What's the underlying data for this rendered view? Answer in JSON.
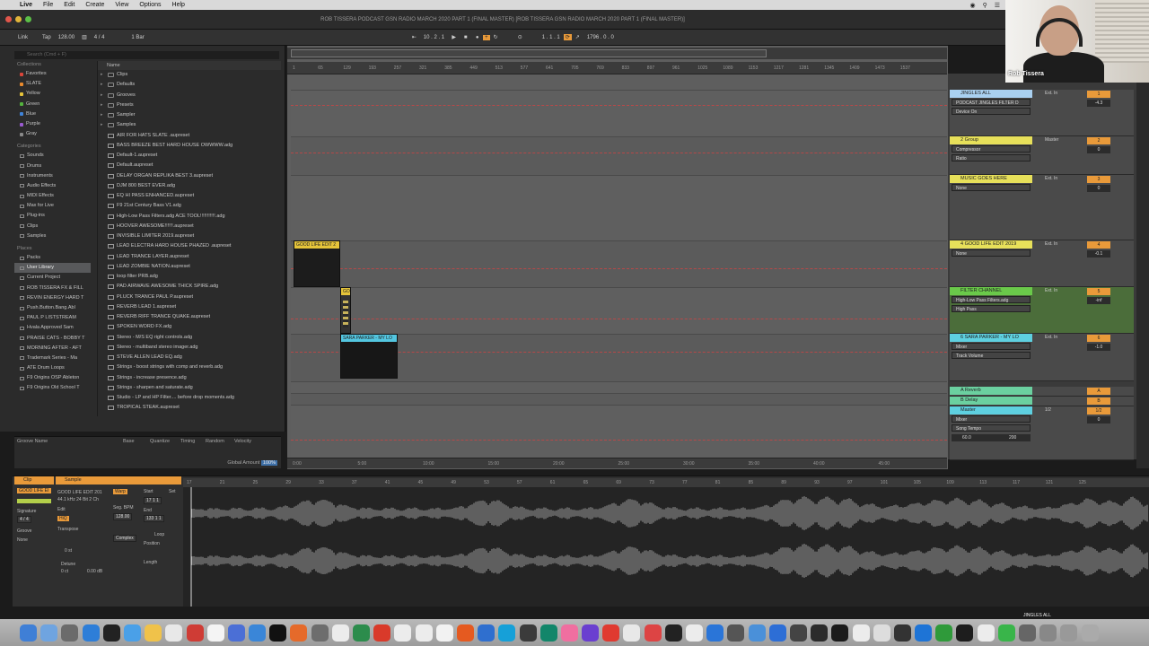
{
  "menubar": {
    "app": "Live",
    "items": [
      "File",
      "Edit",
      "Create",
      "View",
      "Options",
      "Help"
    ]
  },
  "window_title": "ROB TISSERA PODCAST GSN RADIO MARCH 2020 PART 1 (FINAL MASTER) [ROB TISSERA GSN RADIO MARCH 2020 PART 1 (FINAL MASTER)]",
  "transport": {
    "link": "Link",
    "tap": "Tap",
    "tempo": "128.00",
    "signature": "4 / 4",
    "quantize": "1 Bar",
    "position": "10 . 2 . 1",
    "loop_start": "1 . 1 . 1",
    "loop_length": "1796 . 0 . 0"
  },
  "browser": {
    "search_placeholder": "Search (Cmd + F)",
    "collections_header": "Collections",
    "collections": [
      {
        "label": "Favorites",
        "color": "#d9463a"
      },
      {
        "label": "SLATE",
        "color": "#e88a2e"
      },
      {
        "label": "Yellow",
        "color": "#e6c33a"
      },
      {
        "label": "Green",
        "color": "#54b33e"
      },
      {
        "label": "Blue",
        "color": "#3f83d9"
      },
      {
        "label": "Purple",
        "color": "#9a5bd0"
      },
      {
        "label": "Gray",
        "color": "#8a8a8a"
      }
    ],
    "categories_header": "Categories",
    "categories": [
      "Sounds",
      "Drums",
      "Instruments",
      "Audio Effects",
      "MIDI Effects",
      "Max for Live",
      "Plug-ins",
      "Clips",
      "Samples"
    ],
    "places_header": "Places",
    "places": [
      "Packs",
      "User Library",
      "Current Project",
      "ROB TISSERA FX & FILL",
      "REVIN ENERGY HARD T",
      "Push.Button.Bang.Abl",
      "PAUL P LISTSTREAM",
      "Hvala Approved Sam",
      "PRAISE CATS - BOBBY T",
      "MORNING AFTER - AFT",
      "Trademark Series - Ma",
      "ATE Drum Loops",
      "F9 Origins OSP Ableton",
      "F9 Origins Old School T"
    ],
    "selected_place": "User Library",
    "name_header": "Name",
    "files": [
      {
        "name": "Clips",
        "dir": true
      },
      {
        "name": "Defaults",
        "dir": true
      },
      {
        "name": "Grooves",
        "dir": true
      },
      {
        "name": "Presets",
        "dir": true
      },
      {
        "name": "Sampler",
        "dir": true
      },
      {
        "name": "Samples",
        "dir": true
      },
      {
        "name": "AIR FOR HATS SLATE .aupreset",
        "dir": false
      },
      {
        "name": "BASS BREEZE BEST HARD HOUSE OWWWW.adg",
        "dir": false
      },
      {
        "name": "Default-1.aupreset",
        "dir": false
      },
      {
        "name": "Default.aupreset",
        "dir": false
      },
      {
        "name": "DELAY ORGAN REPLIKA BEST 3.aupreset",
        "dir": false
      },
      {
        "name": "DJM 800 BEST EVER.adg",
        "dir": false
      },
      {
        "name": "EQ HI PASS ENHANCED.aupreset",
        "dir": false
      },
      {
        "name": "F9 21st Century Bass V1.adg",
        "dir": false
      },
      {
        "name": "High-Low Pass Filters.adg ACE TOOL!!!!!!!!!!!.adg",
        "dir": false
      },
      {
        "name": "HOOVER AWESOME!!!!!!.aupreset",
        "dir": false
      },
      {
        "name": "INVISIBLE LIMITER 2019.aupreset",
        "dir": false
      },
      {
        "name": "LEAD ELECTRA HARD HOUSE PHAZED .aupreset",
        "dir": false
      },
      {
        "name": "LEAD TRANCE LAYER.aupreset",
        "dir": false
      },
      {
        "name": "LEAD ZOMBIE NATION.aupreset",
        "dir": false
      },
      {
        "name": "loop filter PRB.adg",
        "dir": false
      },
      {
        "name": "PAD AIRWAVE AWESOME THICK SPIRE.adg",
        "dir": false
      },
      {
        "name": "PLUCK TRANCE PAUL P.aupreset",
        "dir": false
      },
      {
        "name": "REVERB LEAD 1.aupreset",
        "dir": false
      },
      {
        "name": "REVERB RIFF TRANCE QUAKE.aupreset",
        "dir": false
      },
      {
        "name": "SPOKEN WORD FX.adg",
        "dir": false
      },
      {
        "name": "Stereo - M/S EQ right controls.adg",
        "dir": false
      },
      {
        "name": "Stereo - multiband stereo imager.adg",
        "dir": false
      },
      {
        "name": "STEVE ALLEN LEAD EQ.adg",
        "dir": false
      },
      {
        "name": "Strings - boost strings with comp and reverb.adg",
        "dir": false
      },
      {
        "name": "Strings - increase presence.adg",
        "dir": false
      },
      {
        "name": "Strings - sharpen and saturate.adg",
        "dir": false
      },
      {
        "name": "Studio - LP and HP Filter.... before drop moments.adg",
        "dir": false
      },
      {
        "name": "TROPICAL STEAK.aupreset",
        "dir": false
      }
    ]
  },
  "groove_pool": {
    "headers": [
      "Groove Name",
      "Base",
      "Quantize",
      "Timing",
      "Random",
      "Velocity"
    ],
    "global_amount_label": "Global Amount",
    "global_amount": "100%"
  },
  "ruler": {
    "bars": [
      "1",
      "65",
      "129",
      "193",
      "257",
      "321",
      "385",
      "449",
      "513",
      "577",
      "641",
      "705",
      "769",
      "833",
      "897",
      "961",
      "1025",
      "1089",
      "1153",
      "1217",
      "1281",
      "1345",
      "1409",
      "1473",
      "1537"
    ],
    "times": [
      "0:00",
      "5:00",
      "10:00",
      "15:00",
      "20:00",
      "25:00",
      "30:00",
      "35:00",
      "40:00",
      "45:00"
    ]
  },
  "clips": {
    "a": "GOOD LIFE EDIT 2",
    "b": "GO",
    "c": "SARA PARKER - MY LO"
  },
  "tracks": [
    {
      "name": "JINGLES ALL",
      "color": "#a9d0f0",
      "num": "1",
      "device": "PODCAST JINGLES FILTER D",
      "device2": "Device On",
      "vol": "-4.3",
      "io": "Ext. In"
    },
    {
      "name": "2 Group",
      "color": "#e7e05a",
      "num": "2",
      "device": "Compressor",
      "device2": "Ratio",
      "vol": "0",
      "io": "Master"
    },
    {
      "name": "MUSIC GOES HERE",
      "color": "#e7e05a",
      "num": "3",
      "device": "None",
      "device2": "",
      "vol": "0",
      "io": "Ext. In"
    },
    {
      "name": "4 GOOD LIFE EDIT 2019",
      "color": "#e7e05a",
      "num": "4",
      "device": "None",
      "device2": "",
      "vol": "-0.1",
      "io": "Ext. In"
    },
    {
      "name": "FILTER CHANNEL",
      "color": "#6ac94a",
      "num": "5",
      "device": "High-Low Pass Filters.adg",
      "device2": "High Pass",
      "vol": "-inf",
      "io": "Ext. In"
    },
    {
      "name": "6 SARA PARKER - MY LO",
      "color": "#5ed0e0",
      "num": "6",
      "device": "Mixer",
      "device2": "Track Volume",
      "vol": "-1.0",
      "io": "Ext. In"
    },
    {
      "name": "A Reverb",
      "color": "#6bd0a0",
      "num": "A",
      "device": "",
      "device2": "",
      "vol": "",
      "io": ""
    },
    {
      "name": "B Delay",
      "color": "#6bd0a0",
      "num": "B",
      "device": "",
      "device2": "",
      "vol": "",
      "io": ""
    },
    {
      "name": "Master",
      "color": "#5ed0e0",
      "num": "1/2",
      "device": "Mixer",
      "device2": "Song Tempo",
      "vol": "0",
      "io": "1/2"
    }
  ],
  "master_tempo": {
    "low": "60.0",
    "high": "200"
  },
  "clip_view": {
    "tab_clip": "Clip",
    "tab_sample": "Sample",
    "clip_name": "GOOD LIFE EI",
    "sample_name": "GOOD LIFE EDIT 201",
    "sample_info": "44.1 kHz 24 Bit 2 Ch",
    "warp": "Warp",
    "start": "Start",
    "set": "Set",
    "end": "End",
    "loop": "Loop",
    "position": "Position",
    "length": "Length",
    "signature_label": "Signature",
    "signature": "4 / 4",
    "groove_label": "Groove",
    "groove": "None",
    "seg_bpm_label": "Seg. BPM",
    "seg_bpm": "128.00",
    "transpose": "Transpose",
    "detune": "Detune",
    "semis": "0 st",
    "cents": "0 ct",
    "gain": "0.00 dB",
    "complex": "Complex",
    "start_val": "17 1 1",
    "end_val": "133 1 1"
  },
  "wave_ruler": [
    "17",
    "21",
    "25",
    "29",
    "33",
    "37",
    "41",
    "45",
    "49",
    "53",
    "57",
    "61",
    "65",
    "69",
    "73",
    "77",
    "81",
    "85",
    "89",
    "93",
    "97",
    "101",
    "105",
    "109",
    "113",
    "117",
    "121",
    "125"
  ],
  "webcam": {
    "name": "Rob Tissera"
  },
  "dock_label": "JINGLES ALL"
}
